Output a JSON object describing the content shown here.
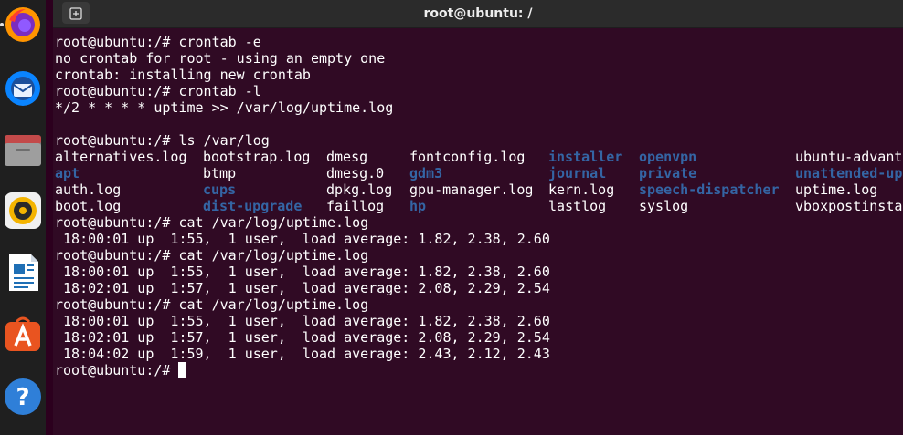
{
  "window": {
    "title": "root@ubuntu: /",
    "new_tab_icon": "new-tab-icon"
  },
  "dock": [
    {
      "name": "firefox",
      "icon": "firefox-icon"
    },
    {
      "name": "thunderbird",
      "icon": "thunderbird-icon"
    },
    {
      "name": "files",
      "icon": "files-icon"
    },
    {
      "name": "rhythmbox",
      "icon": "rhythmbox-icon"
    },
    {
      "name": "libreoffice-writer",
      "icon": "writer-icon"
    },
    {
      "name": "ubuntu-software",
      "icon": "software-icon"
    },
    {
      "name": "help",
      "icon": "help-icon"
    }
  ],
  "terminal": {
    "lines": [
      "root@ubuntu:/# crontab -e",
      "no crontab for root - using an empty one",
      "crontab: installing new crontab",
      "root@ubuntu:/# crontab -l",
      "*/2 * * * * uptime >> /var/log/uptime.log",
      "",
      "root@ubuntu:/# ls /var/log"
    ],
    "ls_rows": [
      [
        "alternatives.log",
        "bootstrap.log",
        "dmesg",
        "fontconfig.log",
        "installer",
        "openvpn",
        "ubuntu-advant"
      ],
      [
        "apt",
        "btmp",
        "dmesg.0",
        "gdm3",
        "journal",
        "private",
        "unattended-up"
      ],
      [
        "auth.log",
        "cups",
        "dpkg.log",
        "gpu-manager.log",
        "kern.log",
        "speech-dispatcher",
        "uptime.log"
      ],
      [
        "boot.log",
        "dist-upgrade",
        "faillog",
        "hp",
        "lastlog",
        "syslog",
        "vboxpostinsta"
      ]
    ],
    "ls_dirs": [
      "installer",
      "openvpn",
      "apt",
      "gdm3",
      "journal",
      "private",
      "unattended-up",
      "cups",
      "speech-dispatcher",
      "dist-upgrade",
      "hp"
    ],
    "after_lines": [
      "root@ubuntu:/# cat /var/log/uptime.log",
      " 18:00:01 up  1:55,  1 user,  load average: 1.82, 2.38, 2.60",
      "root@ubuntu:/# cat /var/log/uptime.log",
      " 18:00:01 up  1:55,  1 user,  load average: 1.82, 2.38, 2.60",
      " 18:02:01 up  1:57,  1 user,  load average: 2.08, 2.29, 2.54",
      "root@ubuntu:/# cat /var/log/uptime.log",
      " 18:00:01 up  1:55,  1 user,  load average: 1.82, 2.38, 2.60",
      " 18:02:01 up  1:57,  1 user,  load average: 2.08, 2.29, 2.54",
      " 18:04:02 up  1:59,  1 user,  load average: 2.43, 2.12, 2.43"
    ],
    "prompt": "root@ubuntu:/# "
  },
  "colors": {
    "terminal_bg": "#300a24",
    "dir_blue": "#3465a4",
    "text": "#ffffff"
  }
}
